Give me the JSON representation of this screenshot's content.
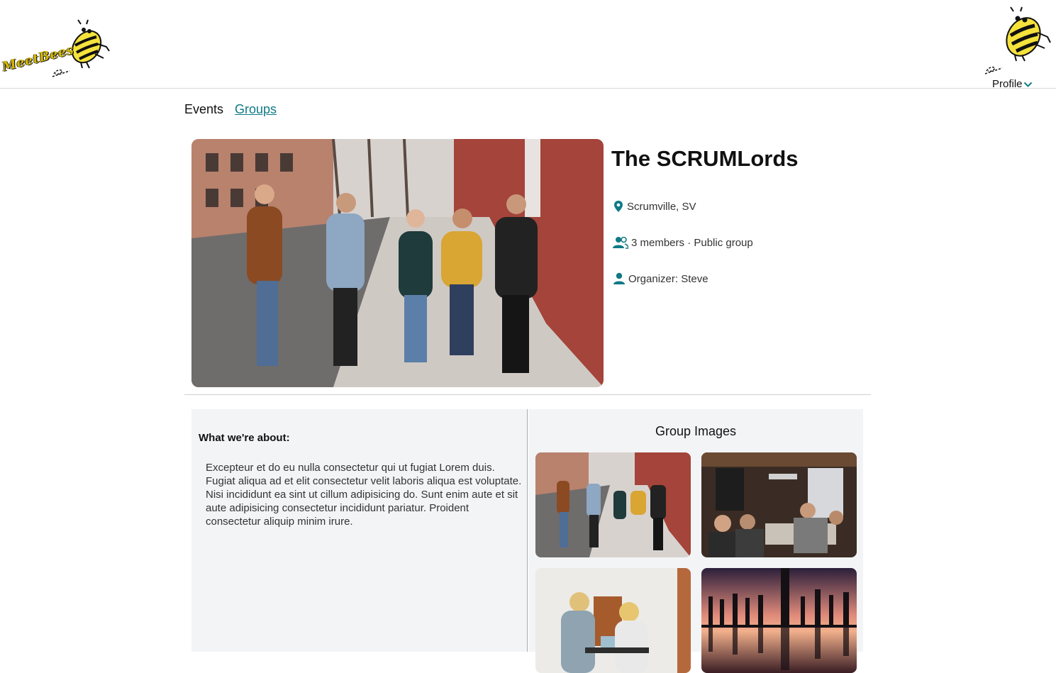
{
  "header": {
    "logo_text": "MeetBees",
    "profile_label": "Profile"
  },
  "tabs": {
    "events": "Events",
    "groups": "Groups"
  },
  "group": {
    "name": "The SCRUMLords",
    "location": "Scrumville, SV",
    "members": "3 members · Public group",
    "organizer": "Organizer: Steve"
  },
  "about": {
    "heading": "What we're about:",
    "text": "Excepteur et do eu nulla consectetur qui ut fugiat Lorem duis. Fugiat aliqua ad et elit consectetur velit laboris aliqua est voluptate. Nisi incididunt ea sint ut cillum adipisicing do. Sunt enim aute et sit aute adipisicing consectetur incididunt pariatur. Proident consectetur aliquip minim irure."
  },
  "images": {
    "heading": "Group Images"
  },
  "colors": {
    "accent": "#0f7a86",
    "panel": "#f3f4f6",
    "bee_yellow": "#f5e23c"
  }
}
